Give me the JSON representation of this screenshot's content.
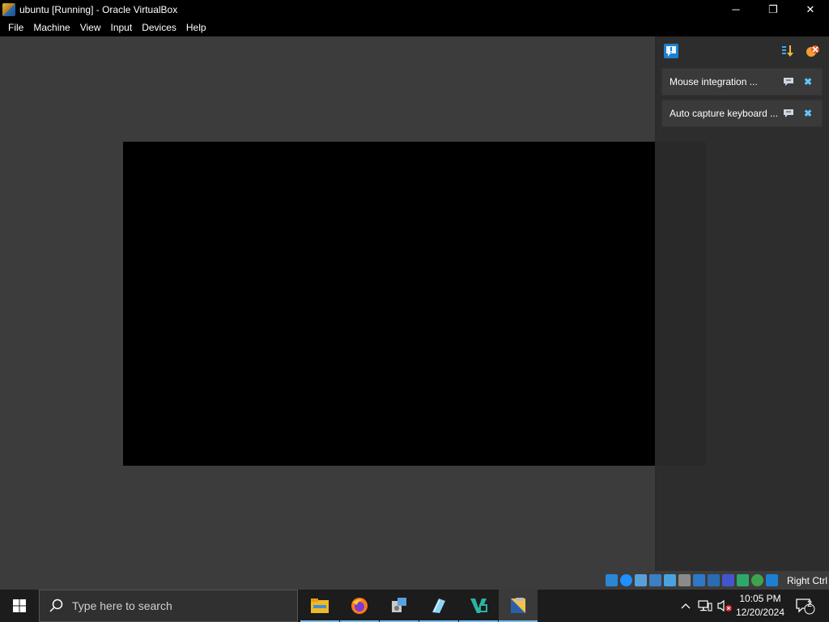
{
  "window": {
    "title": "ubuntu [Running] - Oracle VirtualBox",
    "minimize_glyph": "─",
    "restore_glyph": "❐",
    "close_glyph": "✕"
  },
  "menu": [
    "File",
    "Machine",
    "View",
    "Input",
    "Devices",
    "Help"
  ],
  "notifications": {
    "toolbar_icons": [
      "notification-center-icon",
      "sort-icon",
      "dismiss-all-icon"
    ],
    "items": [
      {
        "text": "Mouse integration ..."
      },
      {
        "text": "Auto capture keyboard ..."
      }
    ]
  },
  "statusbar": {
    "icons": [
      "hard-disk-icon",
      "optical-drive-icon",
      "audio-icon",
      "network-icon",
      "usb-icon",
      "shared-folders-icon",
      "display-icon",
      "video-capture-icon",
      "virtualization-icon",
      "cpu-icon",
      "mouse-integration-icon",
      "keyboard-capture-icon"
    ],
    "host_key": "Right Ctrl"
  },
  "taskbar": {
    "search_placeholder": "Type here to search",
    "apps": [
      "file-explorer-icon",
      "firefox-icon",
      "app-installer-icon",
      "notepad-icon",
      "visual-studio-icon",
      "virtualbox-icon"
    ],
    "time": "10:05 PM",
    "date": "12/20/2024",
    "notification_count": "2"
  },
  "colors": {
    "accent": "#76b9ed",
    "vm_background": "#3c3c3c",
    "taskbar": "#1c1c1c"
  }
}
